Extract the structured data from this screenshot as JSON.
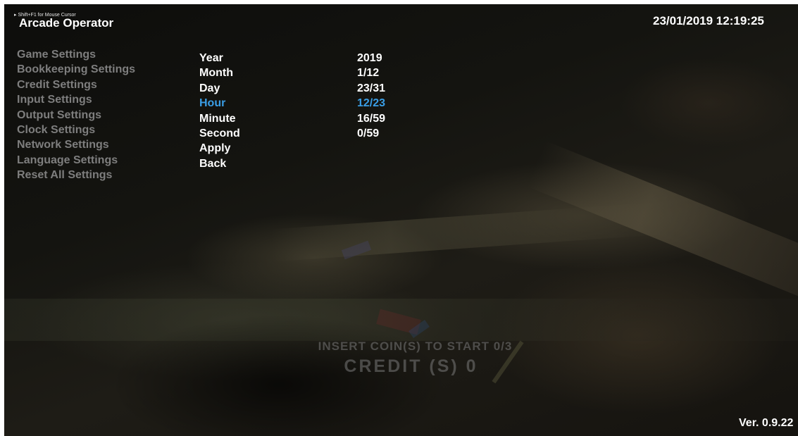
{
  "header": {
    "hint": "Shift+F1 for Mouse Cursor",
    "title": "Arcade Operator",
    "datetime": "23/01/2019  12:19:25"
  },
  "nav": {
    "items": [
      {
        "label": "Game Settings"
      },
      {
        "label": "Bookkeeping Settings"
      },
      {
        "label": "Credit Settings"
      },
      {
        "label": "Input Settings"
      },
      {
        "label": "Output Settings"
      },
      {
        "label": "Clock Settings"
      },
      {
        "label": "Network Settings"
      },
      {
        "label": "Language Settings"
      },
      {
        "label": "Reset All Settings"
      }
    ]
  },
  "clock_settings": {
    "selected_index": 3,
    "rows": [
      {
        "label": "Year",
        "value": "2019"
      },
      {
        "label": "Month",
        "value": "1/12"
      },
      {
        "label": "Day",
        "value": "23/31"
      },
      {
        "label": "Hour",
        "value": "12/23"
      },
      {
        "label": "Minute",
        "value": "16/59"
      },
      {
        "label": "Second",
        "value": "0/59"
      },
      {
        "label": "Apply",
        "value": ""
      },
      {
        "label": "Back",
        "value": ""
      }
    ]
  },
  "attract": {
    "insert_text": "INSERT COIN(S) TO START 0/3",
    "credit_text": "CREDIT (S)  0"
  },
  "footer": {
    "version": "Ver. 0.9.22"
  },
  "colors": {
    "text": "#ffffff",
    "menu_inactive": "#7e7e7e",
    "selected": "#3a9ee6"
  }
}
